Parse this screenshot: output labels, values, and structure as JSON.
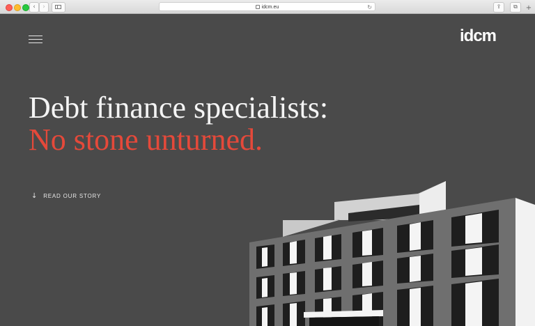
{
  "browser": {
    "url": "idcm.eu",
    "back_glyph": "‹",
    "forward_glyph": "›",
    "reload_glyph": "↻",
    "share_glyph": "⇪",
    "tabs_glyph": "⧉",
    "newtab_glyph": "+"
  },
  "header": {
    "logo": "idcm",
    "menu_icon": "hamburger-icon"
  },
  "hero": {
    "headline_line1": "Debt finance specialists:",
    "headline_line2": "No stone unturned.",
    "cta_arrow": "↓",
    "cta_label": "READ OUR STORY"
  },
  "colors": {
    "page_background": "#4a4a4a",
    "accent": "#e5493a",
    "text": "#f4f4f4"
  }
}
